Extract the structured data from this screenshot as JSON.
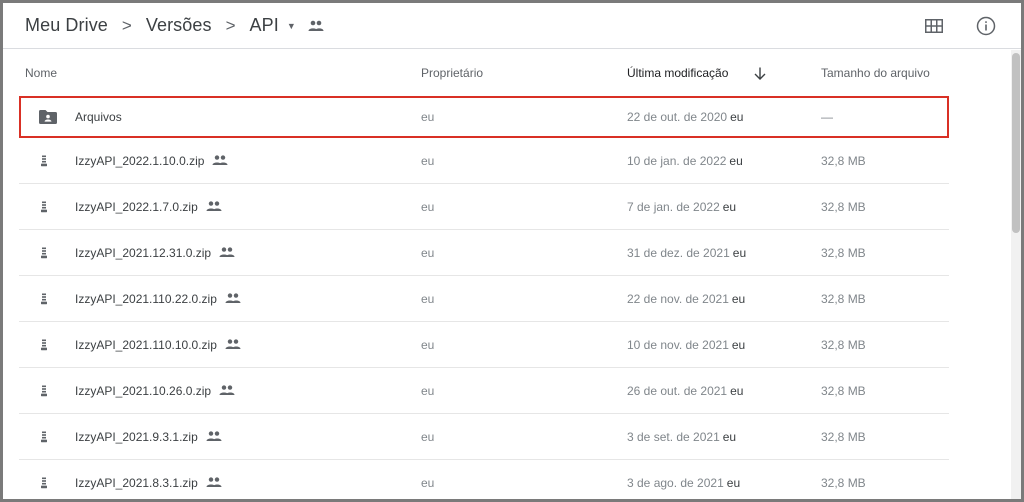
{
  "breadcrumb": {
    "items": [
      "Meu Drive",
      "Versões",
      "API"
    ],
    "separator": ">"
  },
  "header": {
    "grid_view_icon": "grid-view-icon",
    "info_icon": "info-icon"
  },
  "columns": {
    "name": "Nome",
    "owner": "Proprietário",
    "modified": "Última modificação",
    "size": "Tamanho do arquivo"
  },
  "rows": [
    {
      "name": "Arquivos",
      "type": "shared-folder",
      "owner": "eu",
      "modified_date": "22 de out. de 2020",
      "modified_by": "eu",
      "size": "—",
      "selected": true,
      "shared": false
    },
    {
      "name": "IzzyAPI_2022.1.10.0.zip",
      "type": "zip",
      "owner": "eu",
      "modified_date": "10 de jan. de 2022",
      "modified_by": "eu",
      "size": "32,8 MB",
      "shared": true
    },
    {
      "name": "IzzyAPI_2022.1.7.0.zip",
      "type": "zip",
      "owner": "eu",
      "modified_date": "7 de jan. de 2022",
      "modified_by": "eu",
      "size": "32,8 MB",
      "shared": true
    },
    {
      "name": "IzzyAPI_2021.12.31.0.zip",
      "type": "zip",
      "owner": "eu",
      "modified_date": "31 de dez. de 2021",
      "modified_by": "eu",
      "size": "32,8 MB",
      "shared": true
    },
    {
      "name": "IzzyAPI_2021.110.22.0.zip",
      "type": "zip",
      "owner": "eu",
      "modified_date": "22 de nov. de 2021",
      "modified_by": "eu",
      "size": "32,8 MB",
      "shared": true
    },
    {
      "name": "IzzyAPI_2021.110.10.0.zip",
      "type": "zip",
      "owner": "eu",
      "modified_date": "10 de nov. de 2021",
      "modified_by": "eu",
      "size": "32,8 MB",
      "shared": true
    },
    {
      "name": "IzzyAPI_2021.10.26.0.zip",
      "type": "zip",
      "owner": "eu",
      "modified_date": "26 de out. de 2021",
      "modified_by": "eu",
      "size": "32,8 MB",
      "shared": true
    },
    {
      "name": "IzzyAPI_2021.9.3.1.zip",
      "type": "zip",
      "owner": "eu",
      "modified_date": "3 de set. de 2021",
      "modified_by": "eu",
      "size": "32,8 MB",
      "shared": true
    },
    {
      "name": "IzzyAPI_2021.8.3.1.zip",
      "type": "zip",
      "owner": "eu",
      "modified_date": "3 de ago. de 2021",
      "modified_by": "eu",
      "size": "32,8 MB",
      "shared": true
    }
  ],
  "colors": {
    "selection_border": "#d93025",
    "icon": "#5f6368",
    "text": "#3c4043",
    "muted": "#80868b"
  }
}
